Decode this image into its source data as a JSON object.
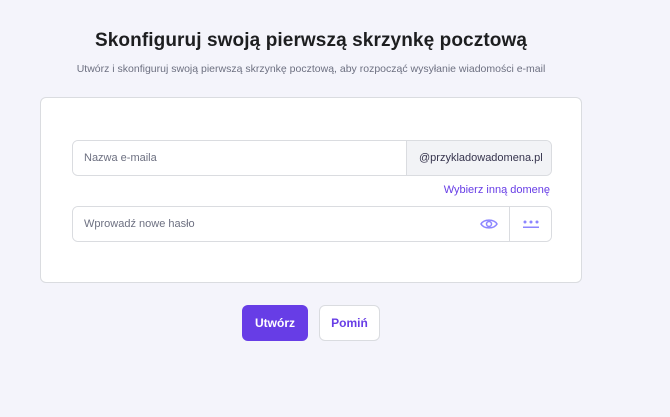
{
  "header": {
    "title": "Skonfiguruj swoją pierwszą skrzynkę pocztową",
    "subtitle": "Utwórz i skonfiguruj swoją pierwszą skrzynkę pocztową, aby rozpocząć wysyłanie wiadomości e-mail"
  },
  "form": {
    "email_placeholder": "Nazwa e-maila",
    "email_value": "",
    "domain": "@przykladowadomena.pl",
    "change_domain_label": "Wybierz inną domenę",
    "password_placeholder": "Wprowadź nowe hasło",
    "password_value": ""
  },
  "icons": {
    "show_password": "eye-icon",
    "generate_password": "password-dots-icon"
  },
  "actions": {
    "create_label": "Utwórz",
    "skip_label": "Pomiń"
  },
  "colors": {
    "accent": "#673de6",
    "background": "#f4f4fb",
    "icon": "#8c85ff"
  }
}
